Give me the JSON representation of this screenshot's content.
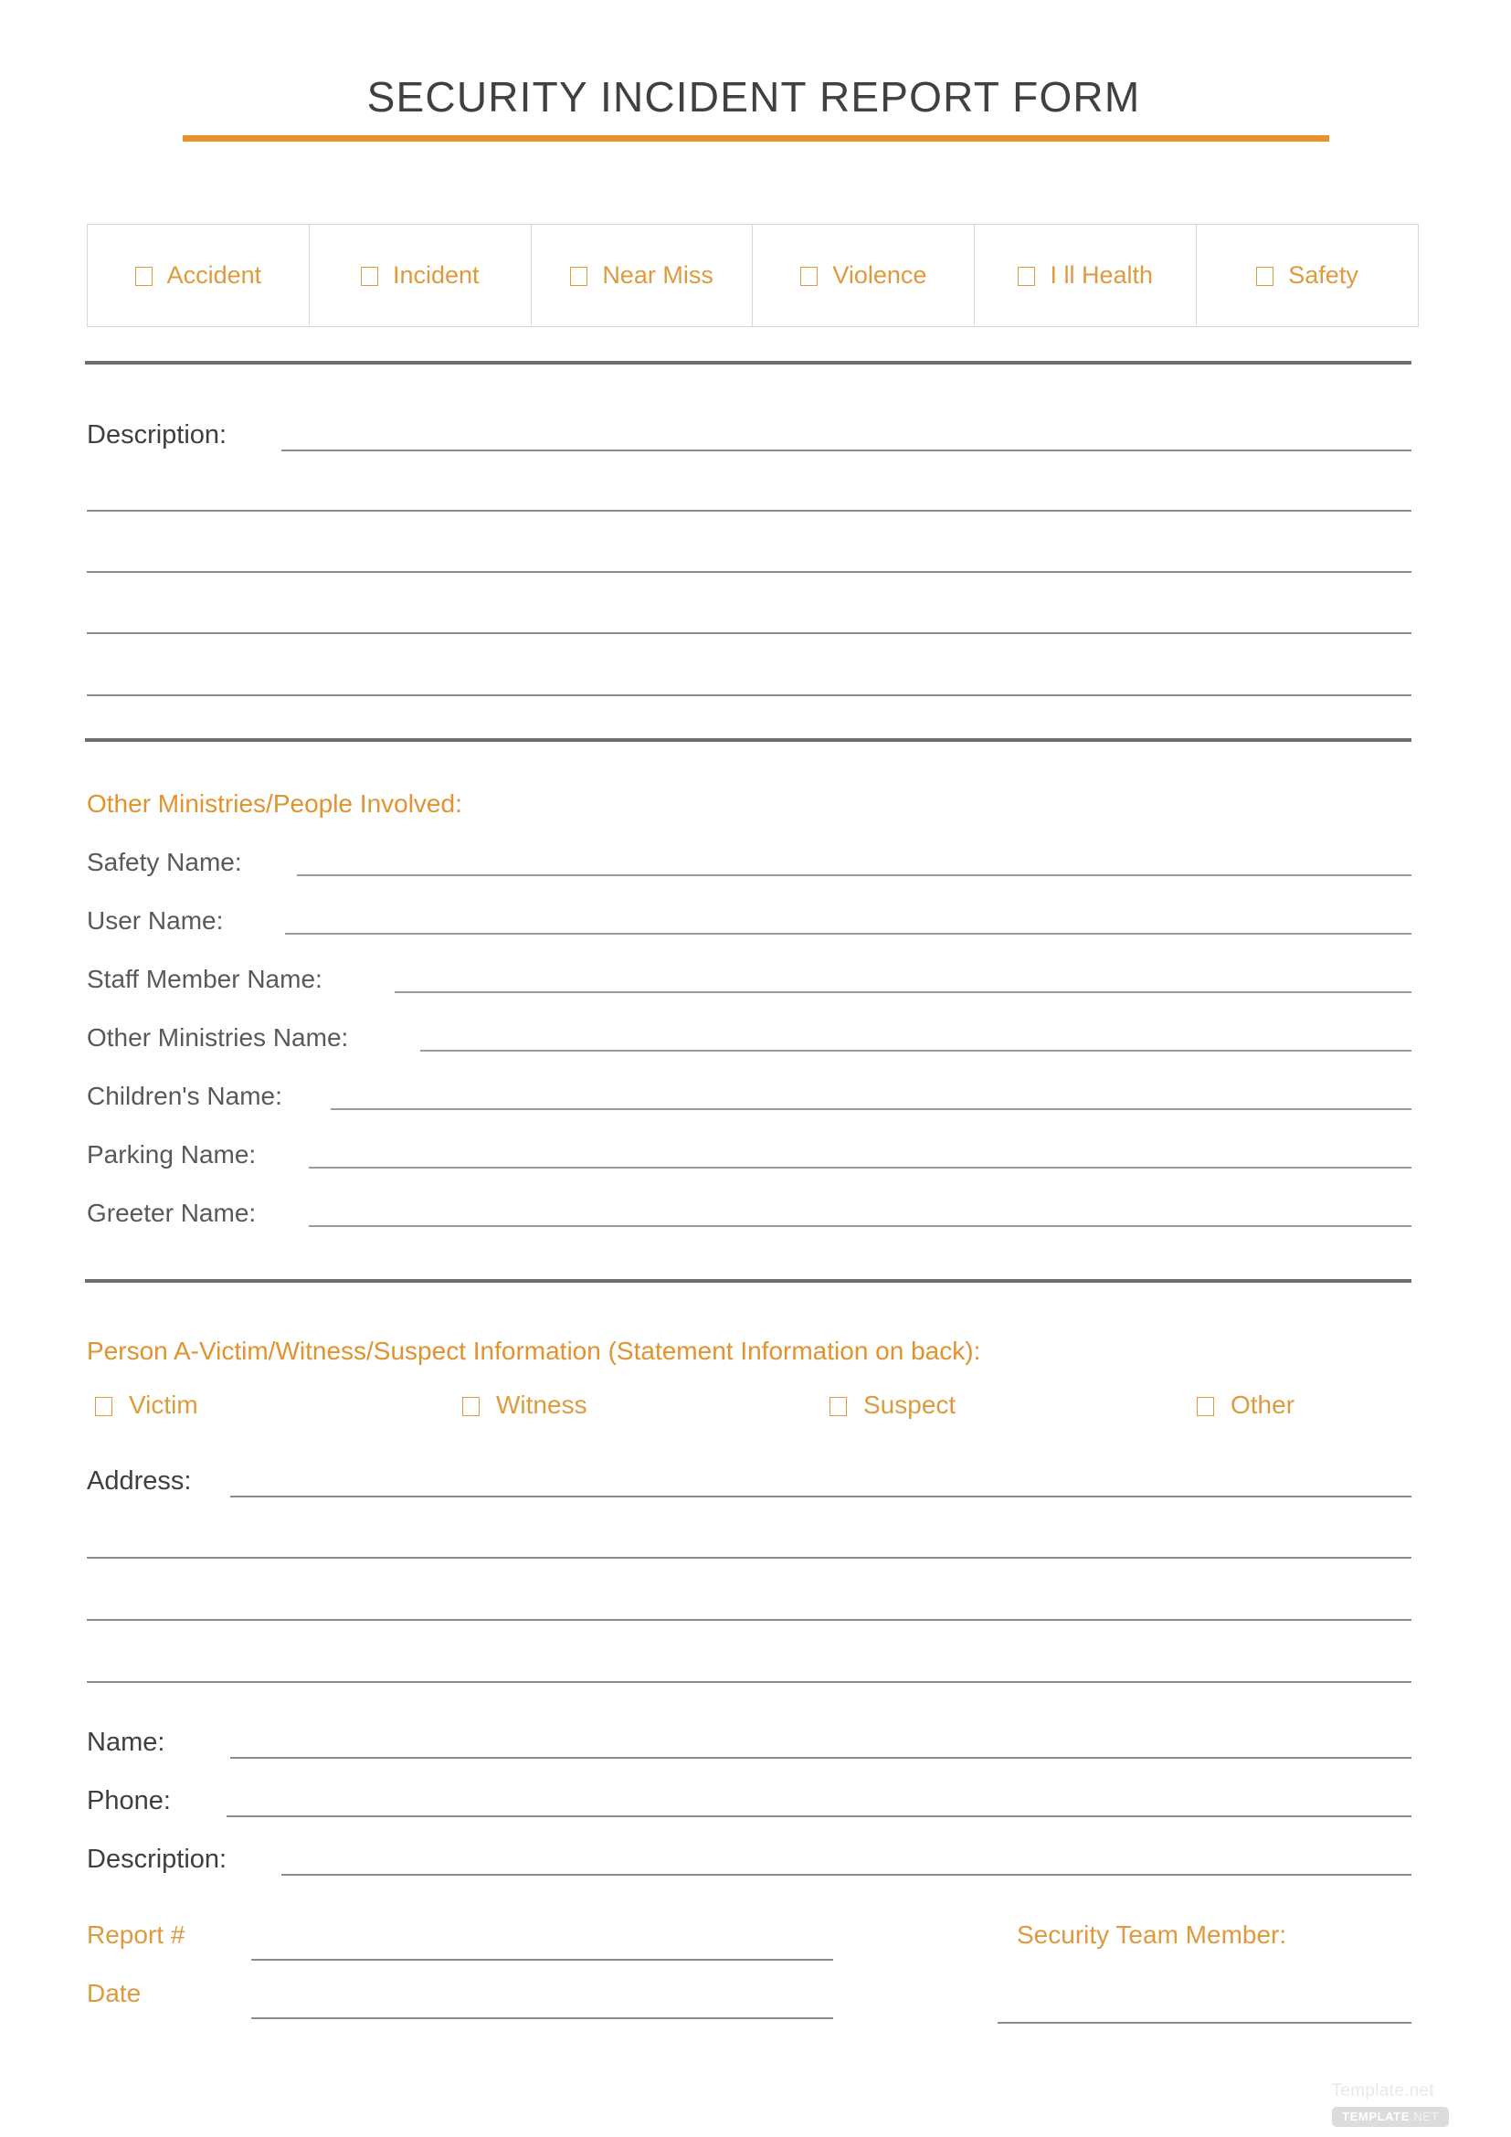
{
  "document": {
    "title": "SECURITY INCIDENT REPORT FORM"
  },
  "colors": {
    "accent_orange": "#e0932f",
    "title_rule": "#e8912a",
    "divider_gray": "#6d6d6d",
    "text_gray": "#58595b",
    "line_gray": "#8c8c8c"
  },
  "incident_types": [
    {
      "label": "Accident",
      "checked": false
    },
    {
      "label": "Incident",
      "checked": false
    },
    {
      "label": "Near Miss",
      "checked": false
    },
    {
      "label": "Violence",
      "checked": false
    },
    {
      "label": "I ll Health",
      "checked": false
    },
    {
      "label": "Safety",
      "checked": false
    }
  ],
  "description_section": {
    "label": "Description:",
    "blank_lines": 5
  },
  "ministries_section": {
    "heading": "Other Ministries/People Involved:",
    "fields": [
      {
        "label": "Safety Name:",
        "value": ""
      },
      {
        "label": "User Name:",
        "value": ""
      },
      {
        "label": "Staff Member Name:",
        "value": ""
      },
      {
        "label": "Other Ministries Name:",
        "value": ""
      },
      {
        "label": "Children's Name:",
        "value": ""
      },
      {
        "label": "Parking Name:",
        "value": ""
      },
      {
        "label": "Greeter Name:",
        "value": ""
      }
    ]
  },
  "person_section": {
    "heading": "Person A-Victim/Witness/Suspect Information (Statement Information on back):",
    "roles": [
      {
        "label": "Victim",
        "checked": false
      },
      {
        "label": "Witness",
        "checked": false
      },
      {
        "label": "Suspect",
        "checked": false
      },
      {
        "label": "Other",
        "checked": false
      }
    ],
    "address_label": "Address:",
    "address_blank_lines": 4,
    "fields": [
      {
        "label": "Name:",
        "value": ""
      },
      {
        "label": "Phone:",
        "value": ""
      },
      {
        "label": "Description:",
        "value": ""
      }
    ]
  },
  "footer": {
    "report_number_label": "Report #",
    "report_number_value": "",
    "date_label": "Date",
    "date_value": "",
    "security_team_member_label": "Security Team Member:",
    "security_team_member_value": ""
  },
  "watermark": {
    "text": "Template.net",
    "badge_bold": "TEMPLATE",
    "badge_light": ".NET"
  }
}
